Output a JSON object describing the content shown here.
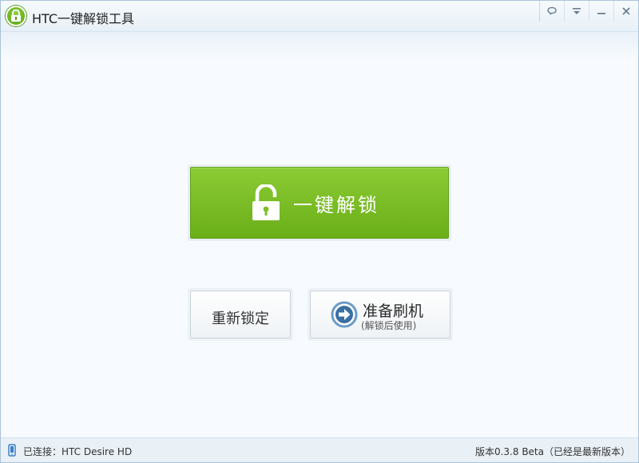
{
  "window": {
    "title": "HTC一键解锁工具",
    "icons": [
      "app-lock-logo",
      "feedback-icon",
      "menu-icon",
      "minimize-icon",
      "close-icon"
    ]
  },
  "main": {
    "unlock_label": "一键解锁",
    "relock_label": "重新锁定",
    "flash_title": "准备刷机",
    "flash_subtitle": "(解锁后使用)"
  },
  "status": {
    "connection": "已连接：HTC Desire HD",
    "version": "版本0.3.8 Beta（已经是最新版本）"
  },
  "colors": {
    "accent_green": "#7dbf27",
    "window_bg": "#f7fbff",
    "arrow_blue": "#3a6ea5"
  }
}
